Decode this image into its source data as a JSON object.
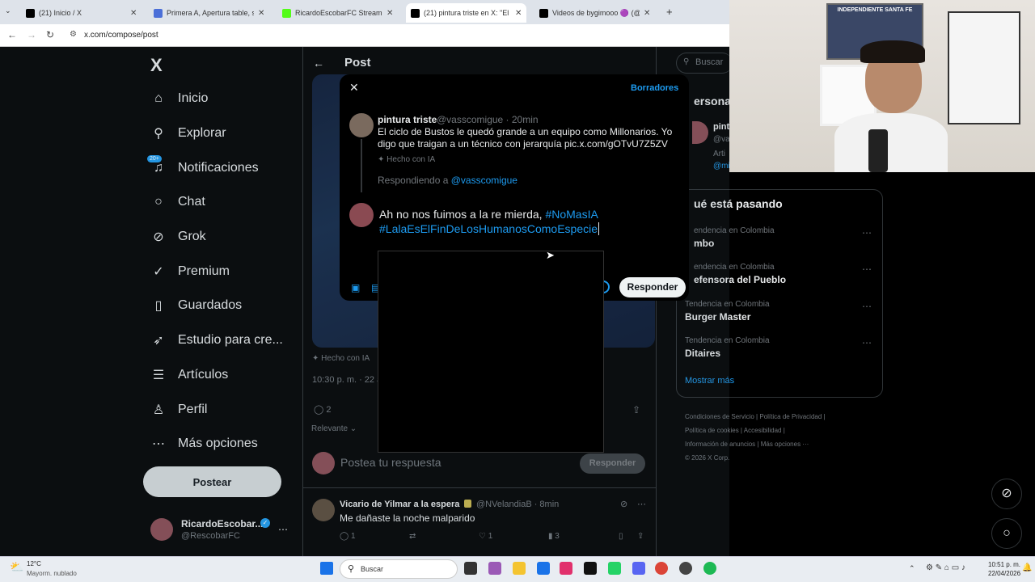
{
  "browser": {
    "tabs": [
      {
        "label": "(21) Inicio / X",
        "color": "#000000"
      },
      {
        "label": "Primera A, Apertura table, sche",
        "color": "#4b6fd8"
      },
      {
        "label": "RicardoEscobarFC Stream - Wa",
        "color": "#53fc18"
      },
      {
        "label": "(21) pintura triste en X: \"El ciclo",
        "color": "#000000"
      },
      {
        "label": "Videos de bygimooo 🟣 (@byg",
        "color": "#000000"
      }
    ],
    "url": "x.com/compose/post"
  },
  "sidebar": {
    "logo": "X",
    "items": [
      {
        "label": "Inicio",
        "icon": "home-icon"
      },
      {
        "label": "Explorar",
        "icon": "search-icon"
      },
      {
        "label": "Notificaciones",
        "icon": "bell-icon",
        "badge": "20+"
      },
      {
        "label": "Chat",
        "icon": "chat-icon"
      },
      {
        "label": "Grok",
        "icon": "grok-icon"
      },
      {
        "label": "Premium",
        "icon": "premium-icon"
      },
      {
        "label": "Guardados",
        "icon": "bookmark-icon"
      },
      {
        "label": "Estudio para cre...",
        "icon": "rocket-icon"
      },
      {
        "label": "Artículos",
        "icon": "article-icon"
      },
      {
        "label": "Perfil",
        "icon": "user-icon"
      },
      {
        "label": "Más opciones",
        "icon": "more-icon"
      }
    ],
    "post_button": "Postear",
    "account": {
      "name": "RicardoEscobar...",
      "handle": "@RescobarFC"
    }
  },
  "center": {
    "header": "Post",
    "ai_label": "Hecho con IA",
    "time": "10:30 p. m. · 22 a",
    "reply_count": "2",
    "sort": "Relevante",
    "reply_placeholder": "Postea tu respuesta",
    "reply_button": "Responder",
    "comment": {
      "name": "Vicario de Yilmar a la espera",
      "handle": "@NVelandiaB · 8min",
      "text": "Me dañaste la noche malparido",
      "replies": "1",
      "likes": "1",
      "views": "3"
    }
  },
  "modal": {
    "drafts": "Borradores",
    "original": {
      "name": "pintura triste",
      "handle": "@vasscomigue · 20min",
      "text": "El ciclo de Bustos le quedó grande a un equipo como Millonarios. Yo digo que traigan a un técnico con jerarquía pic.x.com/gOTvU7Z5ZV",
      "ai_label": "Hecho con IA"
    },
    "replying_prefix": "Respondiendo a",
    "replying_handle": "@vasscomigue",
    "compose_text": "Ah no nos fuimos a la re mierda, ",
    "hashtag1": "#NoMasIA",
    "hashtag2": "#LalaEsElFinDeLosHumanosComoEspecie",
    "reply_button": "Responder"
  },
  "right": {
    "search_placeholder": "Buscar",
    "persons_title": "ersona",
    "person": {
      "name": "pint",
      "line2": "@va",
      "line3": "Arti",
      "line4": "@mi"
    },
    "trends_title": "ué está pasando",
    "trends": [
      {
        "context": "endencia en Colombia",
        "name": "mbo"
      },
      {
        "context": "endencia en Colombia",
        "name": "efensora del Pueblo"
      },
      {
        "context": "Tendencia en Colombia",
        "name": "Burger Master"
      },
      {
        "context": "Tendencia en Colombia",
        "name": "Ditaires"
      }
    ],
    "show_more": "Mostrar más",
    "footer": [
      "Condiciones de Servicio",
      "Política de Privacidad",
      "Política de cookies",
      "Accesibilidad",
      "Información de anuncios",
      "Más opciones ···",
      "© 2026 X Corp."
    ]
  },
  "webcam": {
    "banner": "INDEPENDIENTE SANTA FE"
  },
  "taskbar": {
    "weather_temp": "12°C",
    "weather_desc": "Mayorm. nublado",
    "search": "Buscar",
    "time": "10:51 p. m.",
    "date": "22/04/2026"
  }
}
